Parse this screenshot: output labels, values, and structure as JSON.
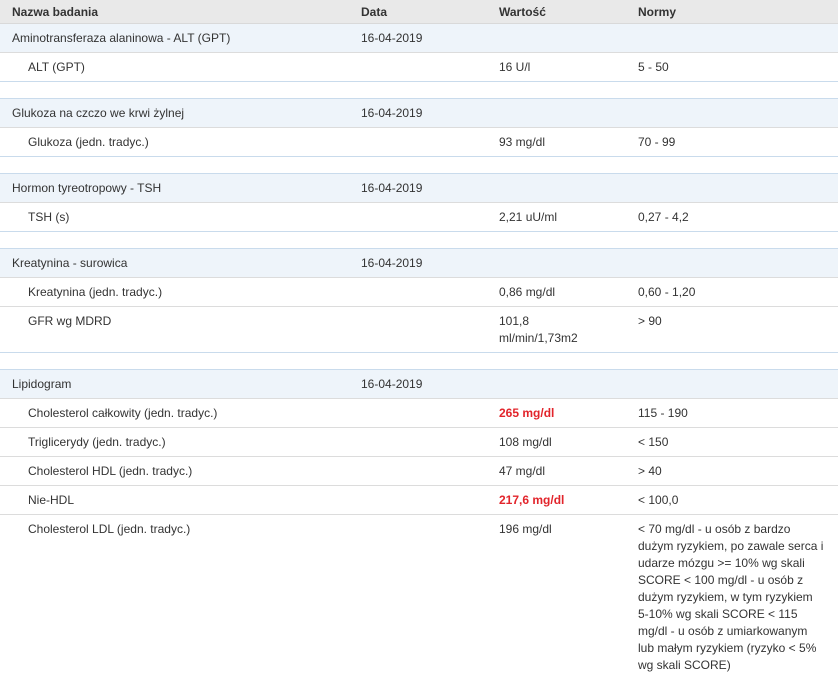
{
  "header": {
    "name": "Nazwa badania",
    "date": "Data",
    "value": "Wartość",
    "norm": "Normy"
  },
  "groups": [
    {
      "name": "Aminotransferaza alaninowa - ALT (GPT)",
      "date": "16-04-2019",
      "results": [
        {
          "name": "ALT (GPT)",
          "value": "16 U/l",
          "norm": "5 - 50",
          "abnormal": false
        }
      ]
    },
    {
      "name": "Glukoza na czczo we krwi żylnej",
      "date": "16-04-2019",
      "results": [
        {
          "name": "Glukoza (jedn. tradyc.)",
          "value": "93 mg/dl",
          "norm": "70 - 99",
          "abnormal": false
        }
      ]
    },
    {
      "name": "Hormon tyreotropowy - TSH",
      "date": "16-04-2019",
      "results": [
        {
          "name": "TSH (s)",
          "value": "2,21 uU/ml",
          "norm": "0,27 - 4,2",
          "abnormal": false
        }
      ]
    },
    {
      "name": "Kreatynina - surowica",
      "date": "16-04-2019",
      "results": [
        {
          "name": "Kreatynina (jedn. tradyc.)",
          "value": "0,86 mg/dl",
          "norm": "0,60 - 1,20",
          "abnormal": false
        },
        {
          "name": "GFR wg MDRD",
          "value": "101,8 ml/min/1,73m2",
          "norm": "> 90",
          "abnormal": false
        }
      ]
    },
    {
      "name": "Lipidogram",
      "date": "16-04-2019",
      "results": [
        {
          "name": "Cholesterol całkowity (jedn. tradyc.)",
          "value": "265 mg/dl",
          "norm": "115 - 190",
          "abnormal": true
        },
        {
          "name": "Triglicerydy (jedn. tradyc.)",
          "value": "108 mg/dl",
          "norm": "< 150",
          "abnormal": false
        },
        {
          "name": "Cholesterol HDL (jedn. tradyc.)",
          "value": "47 mg/dl",
          "norm": "> 40",
          "abnormal": false
        },
        {
          "name": "Nie-HDL",
          "value": "217,6 mg/dl",
          "norm": "< 100,0",
          "abnormal": true
        },
        {
          "name": "Cholesterol LDL (jedn. tradyc.)",
          "value": "196 mg/dl",
          "norm": "< 70 mg/dl - u osób z bardzo dużym ryzykiem, po zawale serca i udarze mózgu >= 10% wg skali SCORE < 100 mg/dl - u osób z dużym ryzykiem, w tym ryzykiem 5-10% wg skali SCORE < 115 mg/dl - u osób z umiarkowanym lub małym ryzykiem (ryzyko < 5% wg skali SCORE)",
          "abnormal": false
        }
      ]
    }
  ],
  "colors": {
    "abnormal": "#e2242b",
    "group_bg": "#eef4fa",
    "header_bg": "#e9e9e9"
  }
}
